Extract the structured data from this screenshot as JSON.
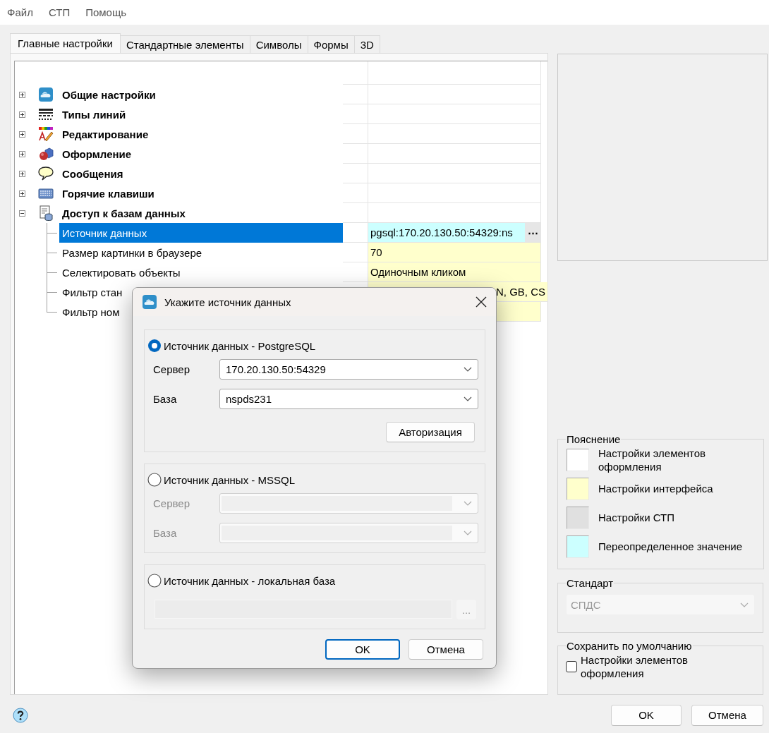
{
  "menu": [
    {
      "label": "Файл"
    },
    {
      "label": "СТП"
    },
    {
      "label": "Помощь"
    }
  ],
  "tabs": [
    {
      "label": "Главные настройки",
      "selected": true
    },
    {
      "label": "Стандартные элементы",
      "selected": false
    },
    {
      "label": "Символы",
      "selected": false
    },
    {
      "label": "Формы",
      "selected": false
    },
    {
      "label": "3D",
      "selected": false
    }
  ],
  "settings_tree": {
    "categories": [
      {
        "label": "Общие настройки",
        "expanded": false
      },
      {
        "label": "Типы линий",
        "expanded": false
      },
      {
        "label": "Редактирование",
        "expanded": false
      },
      {
        "label": "Оформление",
        "expanded": false
      },
      {
        "label": "Сообщения",
        "expanded": false
      },
      {
        "label": "Горячие клавиши",
        "expanded": false
      },
      {
        "label": "Доступ к базам данных",
        "expanded": true,
        "children": [
          {
            "label": "Источник данных",
            "value": "pgsql:170.20.130.50:54329:ns",
            "color": "#ccffff",
            "selected": true,
            "browse_label": "⋯"
          },
          {
            "label": "Размер картинки в браузере",
            "value": "70",
            "color": "#ffffcc",
            "selected": false
          },
          {
            "label": "Селектировать объекты",
            "value": "Одиночным кликом",
            "color": "#ffffcc",
            "selected": false
          },
          {
            "label": "Фильтр стан",
            "value": "N, GB, CS",
            "color": "#ffffcc",
            "selected": false
          },
          {
            "label": "Фильтр ном",
            "color": "#ffffcc",
            "selected": false
          }
        ]
      }
    ]
  },
  "legend": {
    "title": "Пояснение",
    "items": [
      {
        "label": "Настройки элементов оформления",
        "color": "#ffffff"
      },
      {
        "label": "Настройки интерфейса",
        "color": "#ffffcc"
      },
      {
        "label": "Настройки СТП",
        "color": "#e0e0e0"
      },
      {
        "label": "Переопределенное значение",
        "color": "#ccffff"
      }
    ]
  },
  "standard": {
    "title": "Стандарт",
    "value": "СПДС",
    "disabled": true
  },
  "save_default": {
    "title": "Сохранить по умолчанию",
    "option": {
      "label": "Настройки элементов оформления",
      "checked": false
    }
  },
  "buttons": [
    {
      "label": "OK"
    },
    {
      "label": "Отмена"
    }
  ],
  "dialog": {
    "title": "Укажите источник данных",
    "sources": [
      {
        "kind": "server",
        "label": "Источник данных - PostgreSQL",
        "selected": true,
        "disabled": false,
        "fields": [
          {
            "label": "Сервер",
            "value": "170.20.130.50:54329"
          },
          {
            "label": "База",
            "value": "nspds231"
          }
        ],
        "button": "Авторизация"
      },
      {
        "kind": "server",
        "label": "Источник данных - MSSQL",
        "selected": false,
        "disabled": true,
        "fields": [
          {
            "label": "Сервер"
          },
          {
            "label": "База"
          }
        ]
      },
      {
        "kind": "file",
        "label": "Источник данных - локальная база",
        "selected": false,
        "disabled": true,
        "browse_label": "..."
      }
    ],
    "buttons": [
      {
        "label": "OK",
        "default": true
      },
      {
        "label": "Отмена",
        "default": false
      }
    ]
  }
}
